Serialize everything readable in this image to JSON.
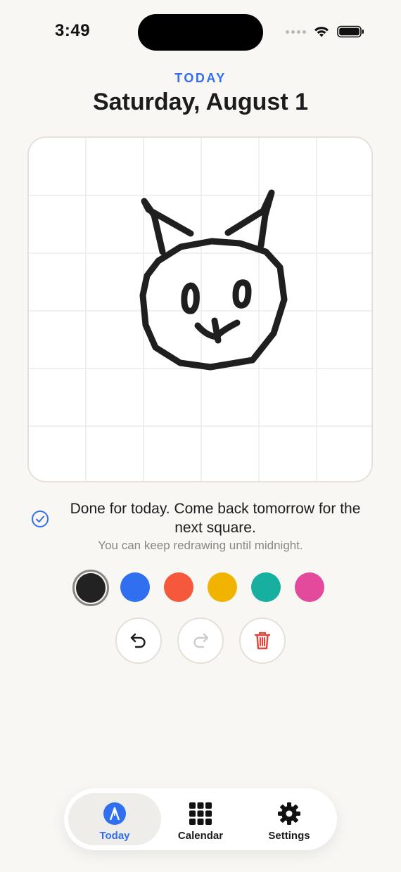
{
  "status_bar": {
    "time": "3:49",
    "icons": [
      "signal-dots-icon",
      "wifi-icon",
      "battery-icon"
    ]
  },
  "header": {
    "eyebrow": "TODAY",
    "title": "Saturday, August 1"
  },
  "canvas": {
    "grid": "on",
    "drawing": "cat-face-sketch",
    "stroke_color": "#1f1f1f"
  },
  "status_message": {
    "icon": "checkmark-circle-icon",
    "text": "Done for today. Come back tomorrow for the next square.",
    "subtext": "You can keep redrawing until midnight."
  },
  "palette": {
    "selected": "black",
    "colors": [
      {
        "name": "black",
        "hex": "#222222"
      },
      {
        "name": "blue",
        "hex": "#2f6ff0"
      },
      {
        "name": "orange",
        "hex": "#f5583a"
      },
      {
        "name": "yellow",
        "hex": "#f2b300"
      },
      {
        "name": "teal",
        "hex": "#17b0a0"
      },
      {
        "name": "pink",
        "hex": "#e44a9c"
      }
    ]
  },
  "tools": {
    "undo": {
      "icon": "undo-icon",
      "enabled": true
    },
    "redo": {
      "icon": "redo-icon",
      "enabled": false
    },
    "clear": {
      "icon": "trash-icon",
      "color": "#e0453a"
    }
  },
  "tabbar": {
    "tabs": [
      {
        "label": "Today",
        "icon": "pen-nib-icon",
        "active": true
      },
      {
        "label": "Calendar",
        "icon": "calendar-grid-icon",
        "active": false
      },
      {
        "label": "Settings",
        "icon": "gear-icon",
        "active": false
      }
    ]
  },
  "colors": {
    "accent": "#2f6ff0",
    "background": "#f8f7f3",
    "danger": "#e0453a"
  }
}
